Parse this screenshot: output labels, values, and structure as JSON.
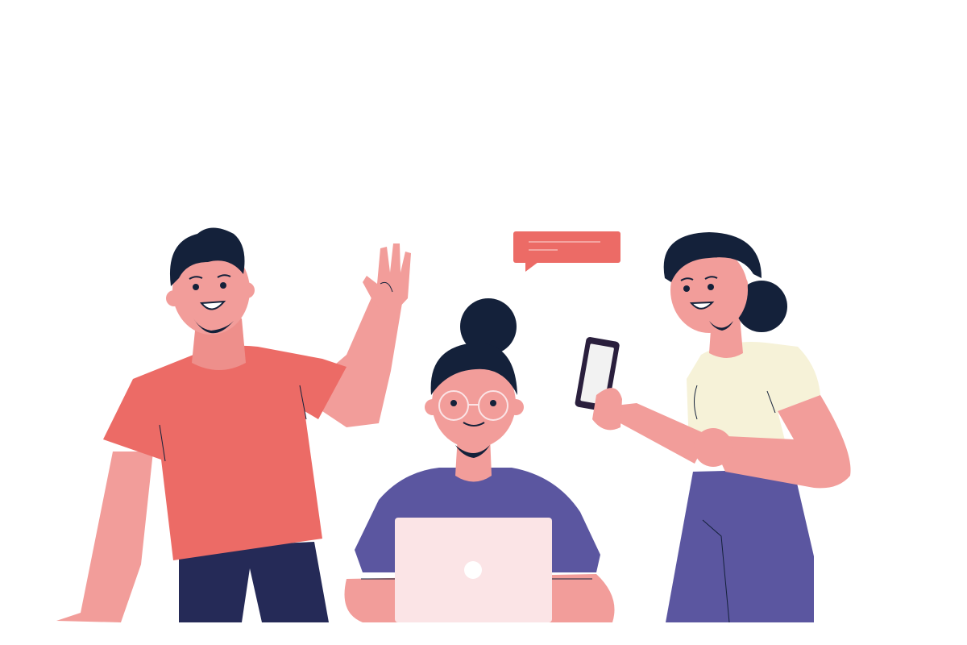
{
  "scene": {
    "description_visible_text": "",
    "colors": {
      "background": "#ffffff",
      "hair": "#14213a",
      "skin": "#f29d9a",
      "skin_dark": "#ee8f8b",
      "red_shirt": "#ec6b66",
      "navy_pants": "#252a57",
      "purple": "#5b56a0",
      "cream_top": "#f6f2d8",
      "laptop": "#fbe4e6",
      "chat_bubble": "#ec6b66",
      "phone": "#2a1f3d",
      "phone_screen": "#f2f2f2"
    },
    "icons": [
      "chat-bubble-icon",
      "laptop-logo-icon"
    ]
  }
}
